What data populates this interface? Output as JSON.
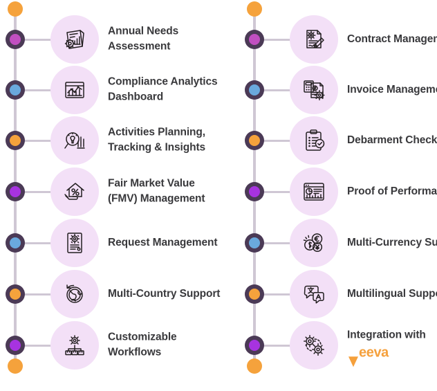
{
  "theme": {
    "background": "#ffffff",
    "spine_color": "#cfc7d4",
    "dot_ring_color": "#4b3a56",
    "bubble_color": "#f3e0f7",
    "text_color": "#39393c",
    "accent_orange": "#f5a23c",
    "accent_blue": "#6aa9dd",
    "accent_magenta": "#c14fc1",
    "accent_purple": "#a733e0",
    "veeva_orange": "#f5a03c"
  },
  "columns": [
    {
      "id": "left",
      "cap_top_color": "#f5a23c",
      "cap_bottom_color": "#f5a23c",
      "items": [
        {
          "label": "Annual Needs Assessment",
          "icon": "document-chart-gear-icon",
          "dot_color": "#c14fc1"
        },
        {
          "label": "Compliance Analytics Dashboard",
          "icon": "analytics-dashboard-icon",
          "dot_color": "#6aa9dd"
        },
        {
          "label": "Activities Planning, Tracking & Insights",
          "icon": "magnifier-lightbulb-bars-icon",
          "dot_color": "#f5a23c"
        },
        {
          "label": "Fair Market Value (FMV) Management",
          "icon": "house-percent-hand-icon",
          "dot_color": "#a733e0"
        },
        {
          "label": "Request Management",
          "icon": "document-gear-icon",
          "dot_color": "#6aa9dd"
        },
        {
          "label": "Multi-Country Support",
          "icon": "globe-refresh-icon",
          "dot_color": "#f5a23c"
        },
        {
          "label": "Customizable Workflows",
          "icon": "gear-workflow-icon",
          "dot_color": "#a733e0"
        }
      ]
    },
    {
      "id": "right",
      "cap_top_color": "#f5a23c",
      "cap_bottom_color": "#f5a23c",
      "items": [
        {
          "label": "Contract Management",
          "icon": "contract-signature-icon",
          "dot_color": "#c14fc1"
        },
        {
          "label": "Invoice Management",
          "icon": "invoice-calculator-gear-icon",
          "dot_color": "#6aa9dd"
        },
        {
          "label": "Debarment Checks",
          "icon": "clipboard-checklist-icon",
          "dot_color": "#f5a23c"
        },
        {
          "label": "Proof of Performance",
          "icon": "report-chart-window-icon",
          "dot_color": "#a733e0"
        },
        {
          "label": "Multi-Currency Support",
          "icon": "multi-currency-coins-icon",
          "dot_color": "#6aa9dd"
        },
        {
          "label": "Multilingual Support",
          "icon": "translation-bubbles-icon",
          "dot_color": "#f5a23c"
        },
        {
          "label": "Integration with",
          "label_suffix_logo": "Veeva",
          "icon": "gears-integration-icon",
          "dot_color": "#a733e0"
        }
      ]
    }
  ]
}
